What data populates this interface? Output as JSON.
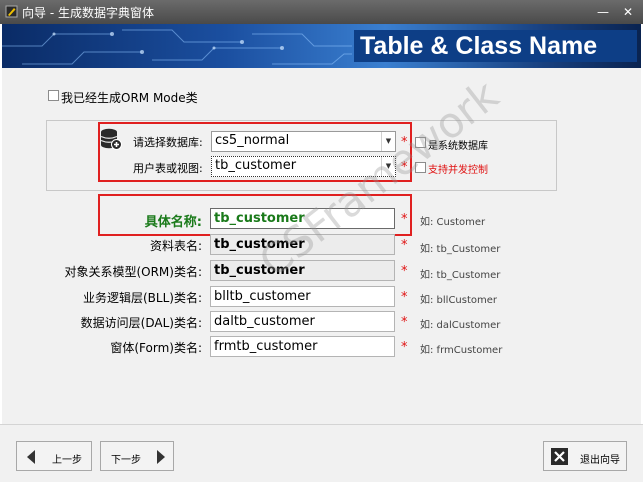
{
  "window": {
    "title": "向导 - 生成数据字典窗体",
    "app_icon": "pencil-icon",
    "minimize_label": "—",
    "close_label": "✕"
  },
  "banner": {
    "title": "Table & Class Name"
  },
  "orm_checkbox": {
    "label": "我已经生成ORM Mode类",
    "checked": false
  },
  "database": {
    "label": "请选择数据库:",
    "value": "cs5_normal",
    "icon": "database-add-icon",
    "required": "*",
    "system_db_label": "是系统数据库",
    "system_db_checked": false
  },
  "table_view": {
    "label": "用户表或视图:",
    "value": "tb_customer",
    "required": "*",
    "concurrency_label": "支持并发控制",
    "concurrency_checked": false
  },
  "fields": [
    {
      "label": "具体名称:",
      "value": "tb_customer",
      "required": "*",
      "hint": "如: Customer"
    },
    {
      "label": "资料表名:",
      "value": "tb_customer",
      "required": "*",
      "hint": "如: tb_Customer"
    },
    {
      "label": "对象关系模型(ORM)类名:",
      "value": "tb_customer",
      "required": "*",
      "hint": "如: tb_Customer"
    },
    {
      "label": "业务逻辑层(BLL)类名:",
      "value": "blltb_customer",
      "required": "*",
      "hint": "如: bllCustomer"
    },
    {
      "label": "数据访问层(DAL)类名:",
      "value": "daltb_customer",
      "required": "*",
      "hint": "如: dalCustomer"
    },
    {
      "label": "窗体(Form)类名:",
      "value": "frmtb_customer",
      "required": "*",
      "hint": "如: frmCustomer"
    }
  ],
  "watermark": "CSFramework",
  "buttons": {
    "prev": "上一步",
    "next": "下一步",
    "exit": "退出向导"
  },
  "colors": {
    "highlight_red": "#e02020",
    "name_green": "#1a7a1a",
    "banner_blue": "#0d3e86"
  }
}
